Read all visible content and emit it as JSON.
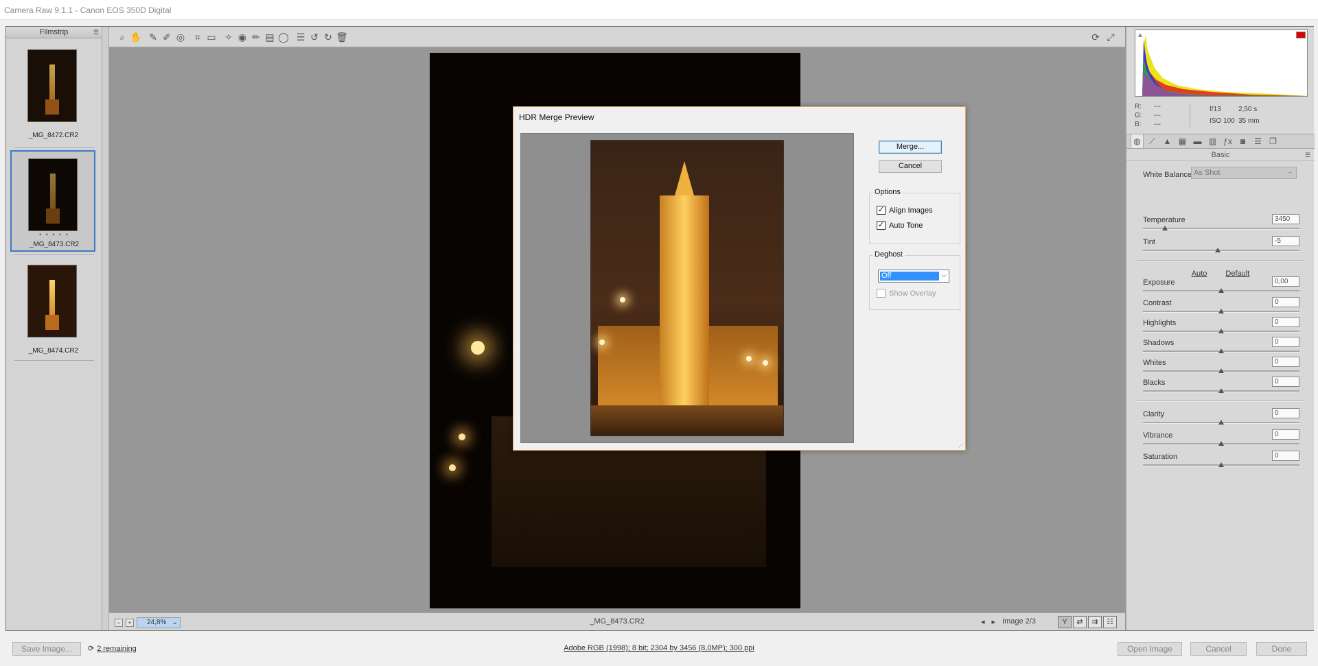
{
  "titlebar": {
    "title": "Camera Raw 9.1.1  -  Canon EOS 350D Digital"
  },
  "filmstrip": {
    "title": "Filmstrip",
    "items": [
      {
        "filename": "_MG_8472.CR2",
        "rating": ""
      },
      {
        "filename": "_MG_8473.CR2",
        "rating": "• • • • •"
      },
      {
        "filename": "_MG_8474.CR2",
        "rating": ""
      }
    ]
  },
  "preview": {
    "zoom": "24,8%",
    "filename": "_MG_8473.CR2",
    "image_counter": "Image 2/3"
  },
  "histogram": {
    "r_label": "R:",
    "r_value": "---",
    "g_label": "G:",
    "g_value": "---",
    "b_label": "B:",
    "b_value": "---",
    "aperture": "f/13",
    "shutter": "2,50 s",
    "iso": "ISO 100",
    "focal": "35 mm"
  },
  "basic_panel": {
    "title": "Basic",
    "white_balance_label": "White Balance:",
    "white_balance_value": "As Shot",
    "auto_label": "Auto",
    "default_label": "Default",
    "sliders": [
      {
        "label": "Temperature",
        "value": "3450",
        "pos": 0.14
      },
      {
        "label": "Tint",
        "value": "-5",
        "pos": 0.48
      },
      {
        "label": "Exposure",
        "value": "0,00",
        "pos": 0.5
      },
      {
        "label": "Contrast",
        "value": "0",
        "pos": 0.5
      },
      {
        "label": "Highlights",
        "value": "0",
        "pos": 0.5
      },
      {
        "label": "Shadows",
        "value": "0",
        "pos": 0.5
      },
      {
        "label": "Whites",
        "value": "0",
        "pos": 0.5
      },
      {
        "label": "Blacks",
        "value": "0",
        "pos": 0.5
      },
      {
        "label": "Clarity",
        "value": "0",
        "pos": 0.5
      },
      {
        "label": "Vibrance",
        "value": "0",
        "pos": 0.5
      },
      {
        "label": "Saturation",
        "value": "0",
        "pos": 0.5
      }
    ]
  },
  "dialog": {
    "title": "HDR Merge Preview",
    "merge_label": "Merge...",
    "cancel_label": "Cancel",
    "options_label": "Options",
    "align_images_label": "Align Images",
    "align_images_checked": true,
    "auto_tone_label": "Auto Tone",
    "auto_tone_checked": true,
    "deghost_label": "Deghost",
    "deghost_value": "Off",
    "show_overlay_label": "Show Overlay",
    "show_overlay_checked": false
  },
  "bottombar": {
    "save_label": "Save Image...",
    "remaining_label": "2 remaining",
    "workflow_label": "Adobe RGB (1998); 8 bit; 2304 by 3456 (8,0MP); 300 ppi",
    "open_label": "Open Image",
    "cancel_label": "Cancel",
    "done_label": "Done"
  },
  "colors": {
    "accent": "#3391ff",
    "selection_border": "#3c78c8",
    "dialog_border": "#d9a46a"
  }
}
